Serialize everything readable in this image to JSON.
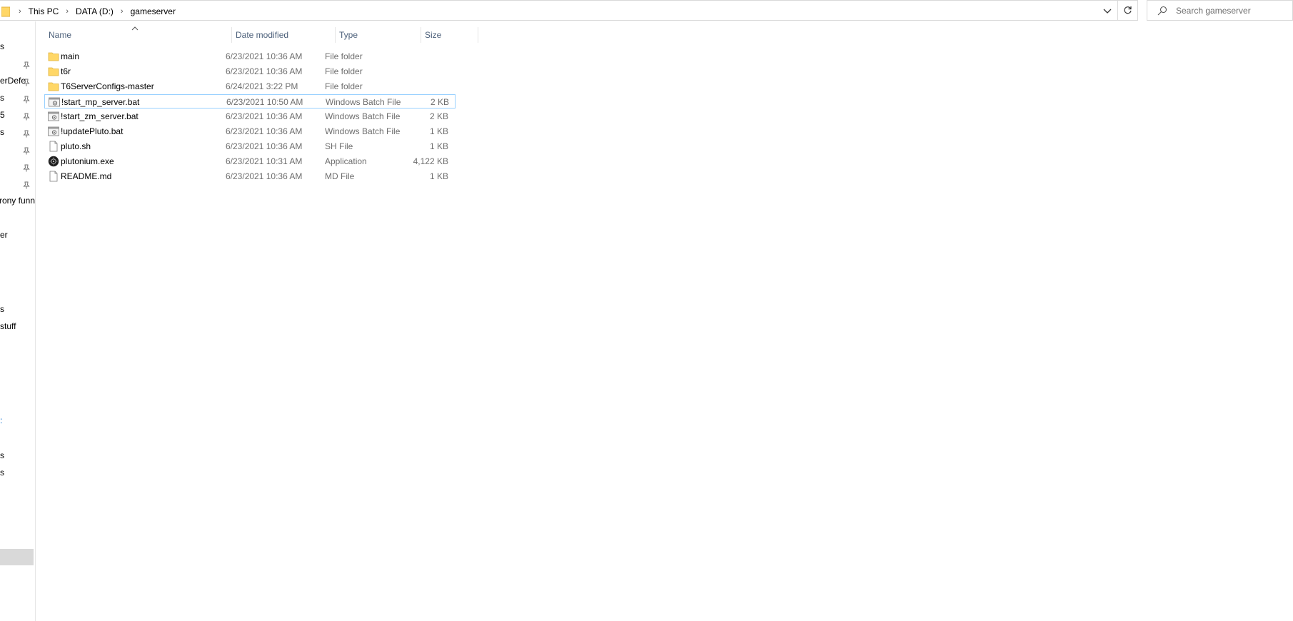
{
  "address": {
    "breadcrumbs": [
      "This PC",
      "DATA (D:)",
      "gameserver"
    ]
  },
  "search": {
    "placeholder": "Search gameserver"
  },
  "navpane": {
    "items": [
      {
        "text": "s"
      },
      {
        "text": ""
      },
      {
        "text": "erDefe"
      },
      {
        "text": "s"
      },
      {
        "text": "5"
      },
      {
        "text": "s"
      },
      {
        "text": ""
      },
      {
        "text": ""
      },
      {
        "text": ""
      },
      {
        "text": "rony funn"
      },
      {
        "text": ""
      },
      {
        "text": "er"
      },
      {
        "text": "s"
      },
      {
        "text": "stuff"
      },
      {
        "text": "s"
      },
      {
        "text": "s"
      }
    ],
    "accent_color": "#0066cc",
    "selected_color": "#d9d9d9"
  },
  "columns": {
    "name": "Name",
    "date": "Date modified",
    "type": "Type",
    "size": "Size"
  },
  "files": [
    {
      "name": "main",
      "date": "6/23/2021 10:36 AM",
      "type": "File folder",
      "size": "",
      "icon": "folder-icon"
    },
    {
      "name": "t6r",
      "date": "6/23/2021 10:36 AM",
      "type": "File folder",
      "size": "",
      "icon": "folder-icon"
    },
    {
      "name": "T6ServerConfigs-master",
      "date": "6/24/2021 3:22 PM",
      "type": "File folder",
      "size": "",
      "icon": "folder-icon"
    },
    {
      "name": "!start_mp_server.bat",
      "date": "6/23/2021 10:50 AM",
      "type": "Windows Batch File",
      "size": "2 KB",
      "icon": "batch-file-icon",
      "focused": true
    },
    {
      "name": "!start_zm_server.bat",
      "date": "6/23/2021 10:36 AM",
      "type": "Windows Batch File",
      "size": "2 KB",
      "icon": "batch-file-icon"
    },
    {
      "name": "!updatePluto.bat",
      "date": "6/23/2021 10:36 AM",
      "type": "Windows Batch File",
      "size": "1 KB",
      "icon": "batch-file-icon"
    },
    {
      "name": "pluto.sh",
      "date": "6/23/2021 10:36 AM",
      "type": "SH File",
      "size": "1 KB",
      "icon": "generic-file-icon"
    },
    {
      "name": "plutonium.exe",
      "date": "6/23/2021 10:31 AM",
      "type": "Application",
      "size": "4,122 KB",
      "icon": "plutonium-app-icon"
    },
    {
      "name": "README.md",
      "date": "6/23/2021 10:36 AM",
      "type": "MD File",
      "size": "1 KB",
      "icon": "generic-file-icon"
    }
  ],
  "colors": {
    "folder": "#ffd767",
    "header_text": "#4c607a",
    "focus_border": "#99d1ff",
    "secondary_text": "#6d6d6d"
  }
}
